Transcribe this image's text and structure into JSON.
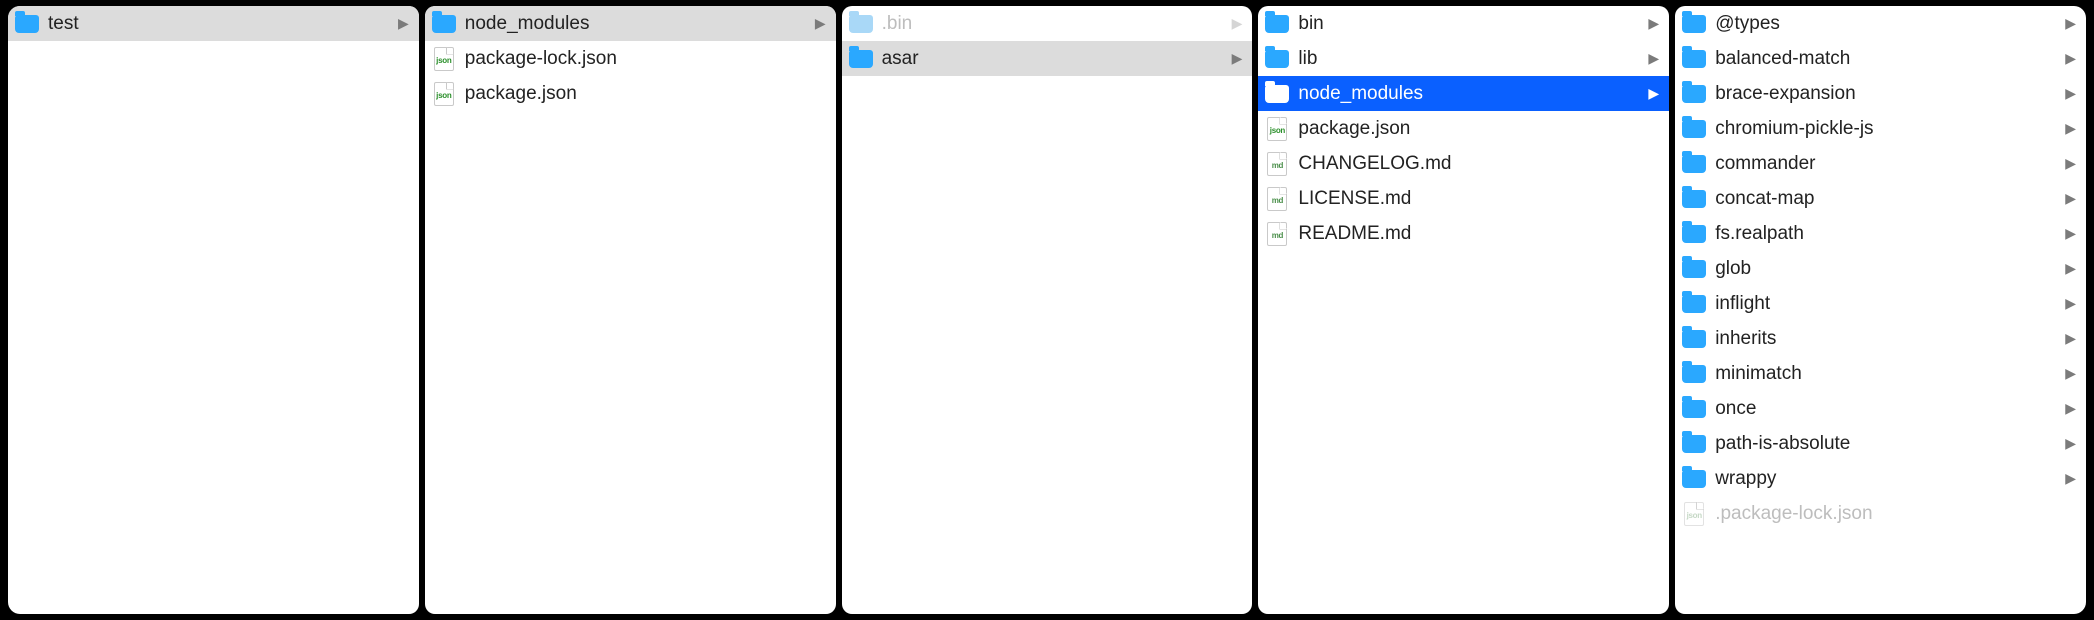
{
  "columns": [
    {
      "items": [
        {
          "name": "test",
          "type": "folder",
          "hasChildren": true,
          "state": "sel-gray"
        }
      ]
    },
    {
      "items": [
        {
          "name": "node_modules",
          "type": "folder",
          "hasChildren": true,
          "state": "sel-gray"
        },
        {
          "name": "package-lock.json",
          "type": "file",
          "file": "json"
        },
        {
          "name": "package.json",
          "type": "file",
          "file": "json"
        }
      ]
    },
    {
      "items": [
        {
          "name": ".bin",
          "type": "folder",
          "hasChildren": true,
          "dim": true,
          "folderTone": "light"
        },
        {
          "name": "asar",
          "type": "folder",
          "hasChildren": true,
          "state": "sel-gray"
        }
      ]
    },
    {
      "items": [
        {
          "name": "bin",
          "type": "folder",
          "hasChildren": true
        },
        {
          "name": "lib",
          "type": "folder",
          "hasChildren": true
        },
        {
          "name": "node_modules",
          "type": "folder",
          "hasChildren": true,
          "state": "sel-blue"
        },
        {
          "name": "package.json",
          "type": "file",
          "file": "json"
        },
        {
          "name": "CHANGELOG.md",
          "type": "file",
          "file": "md"
        },
        {
          "name": "LICENSE.md",
          "type": "file",
          "file": "md"
        },
        {
          "name": "README.md",
          "type": "file",
          "file": "md"
        }
      ]
    },
    {
      "items": [
        {
          "name": "@types",
          "type": "folder",
          "hasChildren": true
        },
        {
          "name": "balanced-match",
          "type": "folder",
          "hasChildren": true
        },
        {
          "name": "brace-expansion",
          "type": "folder",
          "hasChildren": true
        },
        {
          "name": "chromium-pickle-js",
          "type": "folder",
          "hasChildren": true
        },
        {
          "name": "commander",
          "type": "folder",
          "hasChildren": true
        },
        {
          "name": "concat-map",
          "type": "folder",
          "hasChildren": true
        },
        {
          "name": "fs.realpath",
          "type": "folder",
          "hasChildren": true
        },
        {
          "name": "glob",
          "type": "folder",
          "hasChildren": true
        },
        {
          "name": "inflight",
          "type": "folder",
          "hasChildren": true
        },
        {
          "name": "inherits",
          "type": "folder",
          "hasChildren": true
        },
        {
          "name": "minimatch",
          "type": "folder",
          "hasChildren": true
        },
        {
          "name": "once",
          "type": "folder",
          "hasChildren": true
        },
        {
          "name": "path-is-absolute",
          "type": "folder",
          "hasChildren": true
        },
        {
          "name": "wrappy",
          "type": "folder",
          "hasChildren": true
        },
        {
          "name": ".package-lock.json",
          "type": "file",
          "file": "json",
          "dim": true
        }
      ]
    }
  ]
}
